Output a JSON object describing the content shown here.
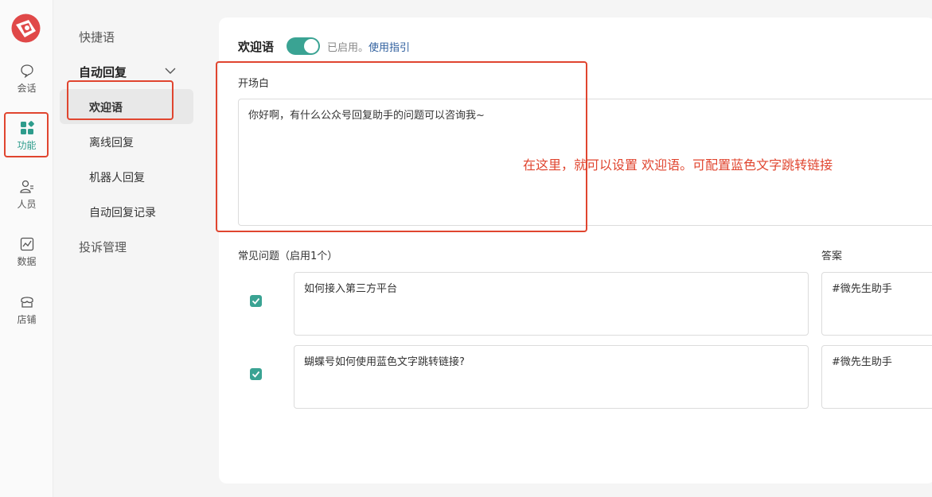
{
  "rail": {
    "items": [
      {
        "label": "会话",
        "icon": "chat-icon"
      },
      {
        "label": "功能",
        "icon": "apps-icon"
      },
      {
        "label": "人员",
        "icon": "people-icon"
      },
      {
        "label": "数据",
        "icon": "chart-icon"
      },
      {
        "label": "店铺",
        "icon": "store-icon"
      }
    ]
  },
  "subnav": {
    "quick_phrases": "快捷语",
    "auto_reply": "自动回复",
    "sub_items": [
      "欢迎语",
      "离线回复",
      "机器人回复",
      "自动回复记录"
    ],
    "complaints": "投诉管理"
  },
  "main": {
    "title": "欢迎语",
    "status": "已启用。",
    "guide_link": "使用指引",
    "opening_label": "开场白",
    "opening_text": "你好啊，有什么公众号回复助手的问题可以咨询我~",
    "faq_label": "常见问题（启用1个）",
    "answer_label": "答案",
    "faqs": [
      {
        "question": "如何接入第三方平台",
        "answer": "#微先生助手"
      },
      {
        "question": "蝴蝶号如何使用蓝色文字跳转链接?",
        "answer": "#微先生助手"
      }
    ]
  },
  "annotation": "在这里，就可以设置 欢迎语。可配置蓝色文字跳转链接",
  "colors": {
    "accent": "#3aa393",
    "highlight": "#e0452f",
    "link": "#2f5f9e"
  }
}
